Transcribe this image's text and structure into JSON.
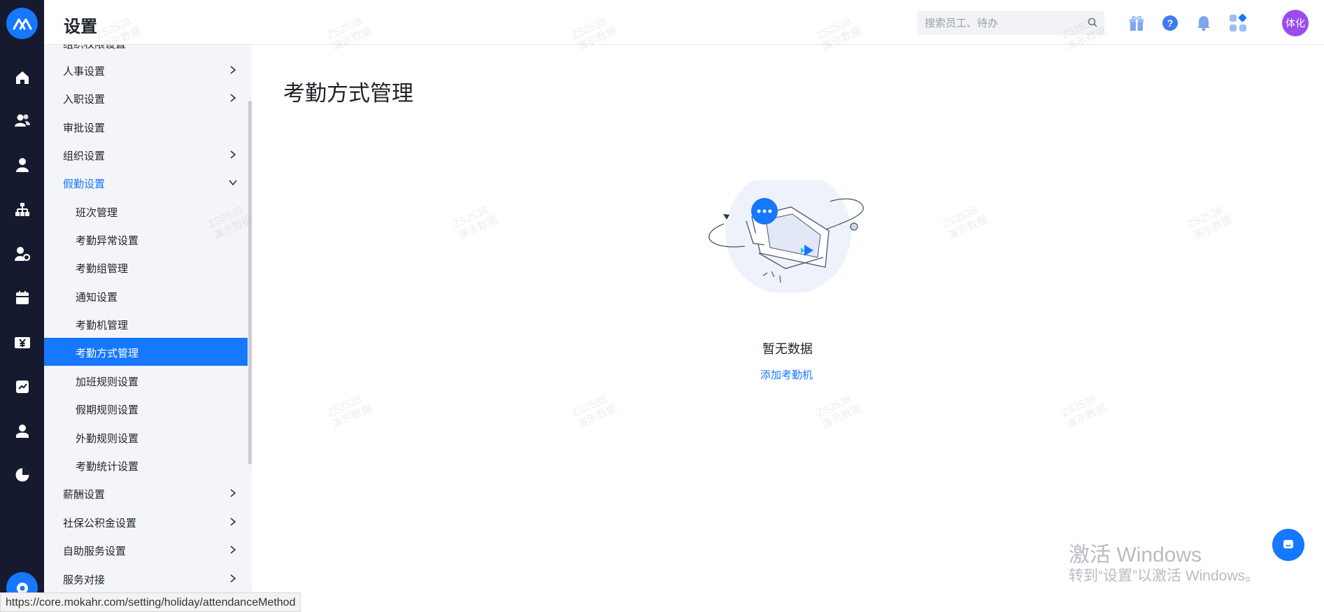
{
  "header": {
    "title": "设置",
    "search_placeholder": "搜索员工、待办",
    "avatar_text": "体化"
  },
  "rail": {
    "icons": [
      "logo-icon",
      "home-icon",
      "team-icon",
      "person-icon",
      "org-chart-icon",
      "person-settings-icon",
      "calendar-icon",
      "salary-icon",
      "report-icon",
      "user-card-icon",
      "pie-chart-icon"
    ]
  },
  "menu": {
    "cut_item": "组织权限设置",
    "items": [
      {
        "label": "人事设置",
        "chevron": "right"
      },
      {
        "label": "入职设置",
        "chevron": "right"
      },
      {
        "label": "审批设置",
        "chevron": ""
      },
      {
        "label": "组织设置",
        "chevron": "right"
      },
      {
        "label": "假勤设置",
        "chevron": "down"
      },
      {
        "label": "班次管理"
      },
      {
        "label": "考勤异常设置"
      },
      {
        "label": "考勤组管理"
      },
      {
        "label": "通知设置"
      },
      {
        "label": "考勤机管理"
      },
      {
        "label": "考勤方式管理"
      },
      {
        "label": "加班规则设置"
      },
      {
        "label": "假期规则设置"
      },
      {
        "label": "外勤规则设置"
      },
      {
        "label": "考勤统计设置"
      },
      {
        "label": "薪酬设置",
        "chevron": "right"
      },
      {
        "label": "社保公积金设置",
        "chevron": "right"
      },
      {
        "label": "自助服务设置",
        "chevron": "right"
      },
      {
        "label": "服务对接",
        "chevron": "right"
      }
    ]
  },
  "main": {
    "title": "考勤方式管理",
    "empty_text": "暂无数据",
    "empty_link": "添加考勤机"
  },
  "overlay": {
    "windows_line1": "激活 Windows",
    "windows_line2": "转到“设置”以激活 Windows。",
    "status_url": "https://core.mokahr.com/setting/holiday/attendanceMethod",
    "watermark_line1": "ZS2538",
    "watermark_line2": "演示数据"
  },
  "colors": {
    "accent": "#1677ff",
    "rail_bg": "#151a2e",
    "menu_bg": "#f3f5f9",
    "avatar_bg": "#9b4cf0"
  }
}
